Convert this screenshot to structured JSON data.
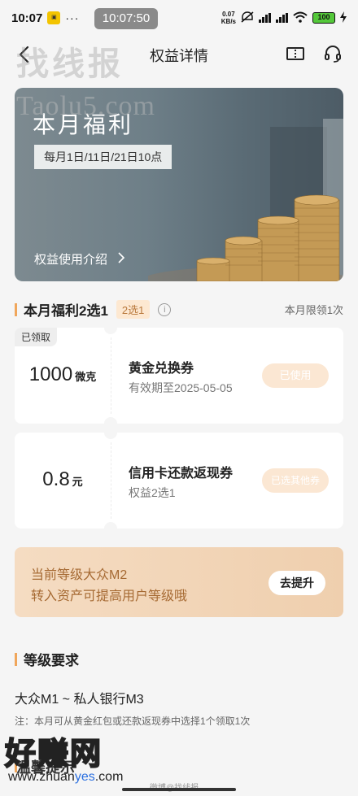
{
  "status": {
    "time": "10:07",
    "dots": "···",
    "clock_pill": "10:07:50",
    "speed_top": "0.07",
    "speed_bottom": "KB/s",
    "battery": "100"
  },
  "nav": {
    "title": "权益详情"
  },
  "watermarks": {
    "top_cn": "找线报",
    "top_url": "Taolu5.com",
    "bottom_cn": "好赚网",
    "bottom_url_a": "www.zhuan",
    "bottom_url_b": "yes",
    "bottom_url_c": ".com",
    "weibo": "微博@找线报"
  },
  "banner": {
    "title": "本月福利",
    "schedule": "每月1日/11日/21日10点",
    "link": "权益使用介绍"
  },
  "section_welfare": {
    "title": "本月福利2选1",
    "tag": "2选1",
    "info_icon": "i",
    "limit": "本月限领1次"
  },
  "coupons": [
    {
      "claimed": "已领取",
      "amount": "1000",
      "unit": "微克",
      "name": "黄金兑换券",
      "sub": "有效期至2025-05-05",
      "button": "已使用"
    },
    {
      "amount": "0.8",
      "unit": "元",
      "name": "信用卡还款返现券",
      "sub": "权益2选1",
      "button": "已选其他券"
    }
  ],
  "level": {
    "line1": "当前等级大众M2",
    "line2": "转入资产可提高用户等级哦",
    "button": "去提升"
  },
  "requirements": {
    "title": "等级要求",
    "range": "大众M1 ~ 私人银行M3",
    "note": "注：本月可从黄金红包或还款返现券中选择1个领取1次"
  },
  "bottom_section": {
    "title": "温馨提示"
  }
}
